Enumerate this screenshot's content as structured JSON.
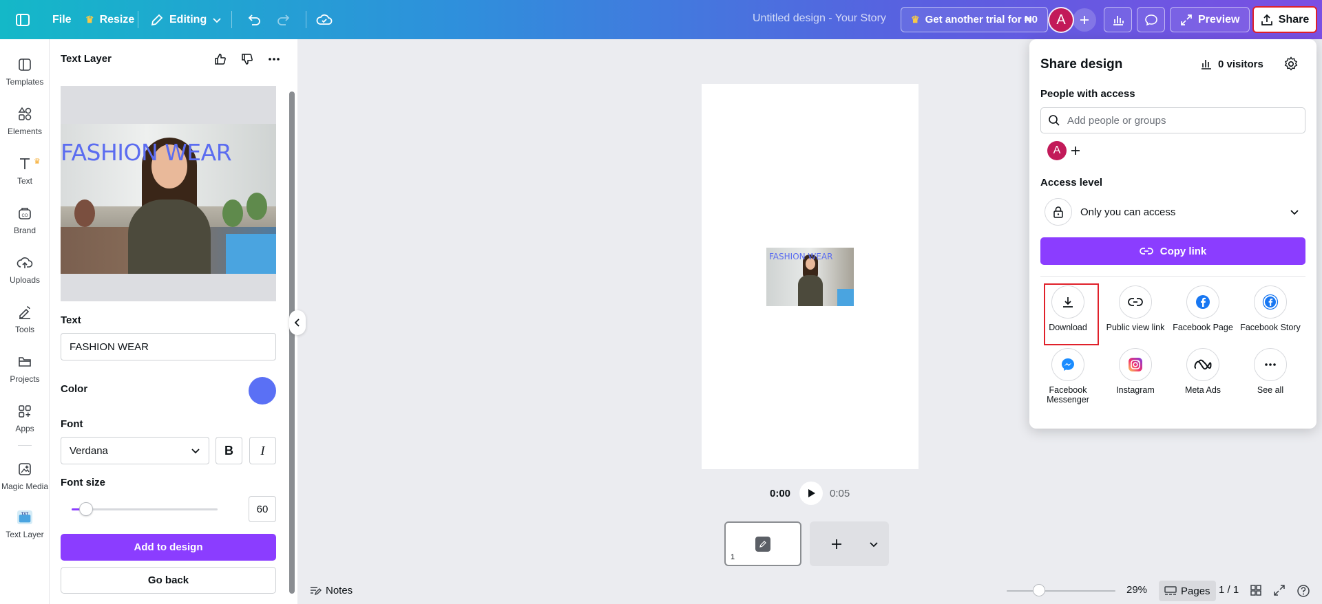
{
  "topbar": {
    "file": "File",
    "resize": "Resize",
    "editing": "Editing",
    "design_title": "Untitled design - Your Story",
    "trial": "Get another trial for ₦0",
    "avatar_letter": "A",
    "preview": "Preview",
    "share": "Share"
  },
  "rail": {
    "items": [
      {
        "label": "Templates"
      },
      {
        "label": "Elements"
      },
      {
        "label": "Text"
      },
      {
        "label": "Brand"
      },
      {
        "label": "Uploads"
      },
      {
        "label": "Tools"
      },
      {
        "label": "Projects"
      },
      {
        "label": "Apps"
      },
      {
        "label": "Magic Media"
      },
      {
        "label": "Text Layer"
      }
    ]
  },
  "panel": {
    "title": "Text Layer",
    "preview_overlay_text": "FASHION WEAR",
    "text_label": "Text",
    "text_value": "FASHION WEAR",
    "color_label": "Color",
    "color_value": "#5a70f5",
    "font_label": "Font",
    "font_value": "Verdana",
    "bold": "B",
    "italic": "I",
    "font_size_label": "Font size",
    "font_size_value": "60",
    "font_size_fraction": 0.1,
    "add_button": "Add to design",
    "back_button": "Go back"
  },
  "canvas": {
    "overlay_text": "FASHION WEAR",
    "time_current": "0:00",
    "time_total": "0:05",
    "page_number": "1"
  },
  "bottombar": {
    "notes": "Notes",
    "zoom": "29%",
    "zoom_fraction": 0.3,
    "pages": "Pages",
    "page_count": "1 / 1"
  },
  "share": {
    "title": "Share design",
    "visitors": "0 visitors",
    "people_label": "People with access",
    "search_placeholder": "Add people or groups",
    "avatar_letter": "A",
    "access_label": "Access level",
    "access_value": "Only you can access",
    "copy_link": "Copy link",
    "options": [
      {
        "label": "Download",
        "icon": "download-icon"
      },
      {
        "label": "Public view link",
        "icon": "link-icon"
      },
      {
        "label": "Facebook Page",
        "icon": "facebook-icon"
      },
      {
        "label": "Facebook Story",
        "icon": "facebook-story-icon"
      },
      {
        "label": "Facebook Messenger",
        "icon": "messenger-icon"
      },
      {
        "label": "Instagram",
        "icon": "instagram-icon"
      },
      {
        "label": "Meta Ads",
        "icon": "meta-icon"
      },
      {
        "label": "See all",
        "icon": "more-icon"
      }
    ]
  },
  "colors": {
    "accent": "#8b3dff",
    "highlight": "#e0202a",
    "avatar": "#c21a59"
  }
}
